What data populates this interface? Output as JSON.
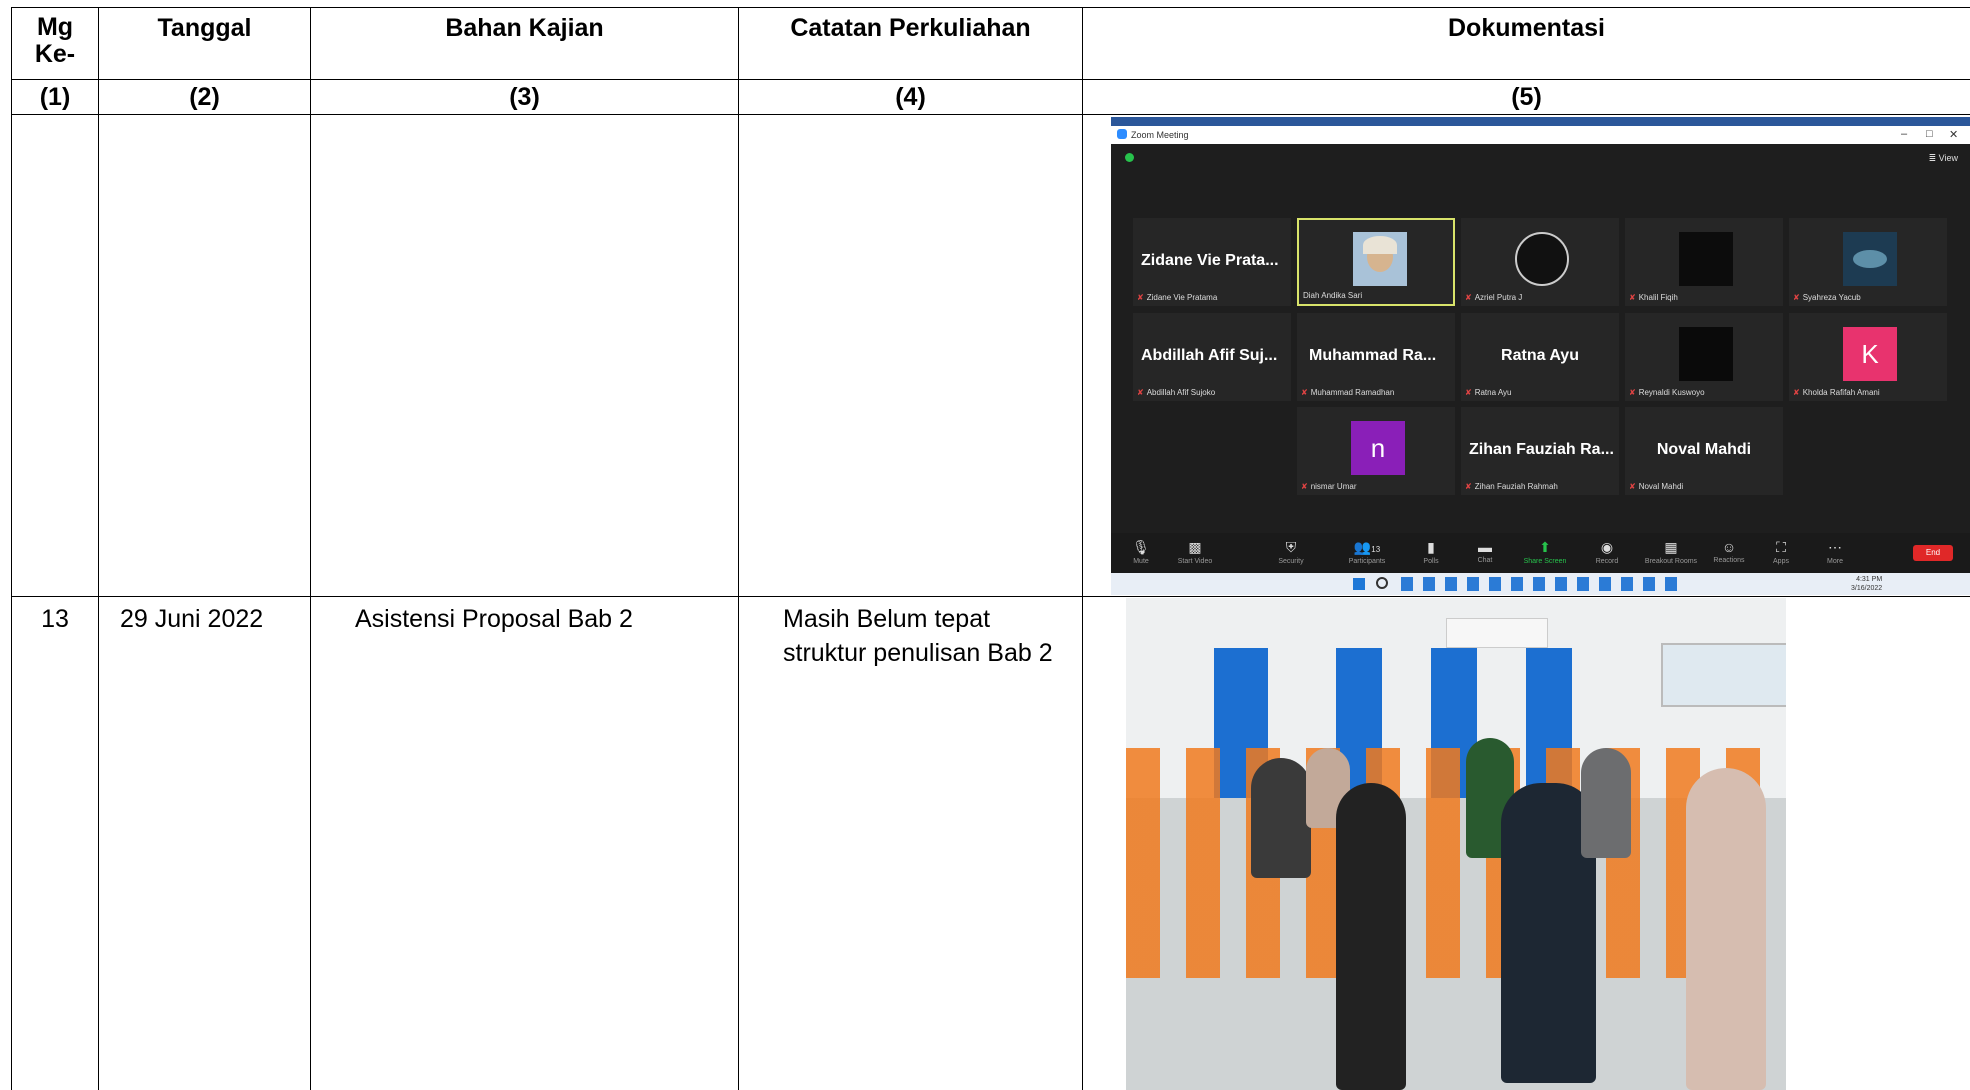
{
  "table": {
    "headers": [
      "Mg\nKe-",
      "Tanggal",
      "Bahan Kajian",
      "Catatan Perkuliahan",
      "Dokumentasi"
    ],
    "header_mg_line1": "Mg",
    "header_mg_line2": "Ke-",
    "numbers": [
      "(1)",
      "(2)",
      "(3)",
      "(4)",
      "(5)"
    ],
    "rows": [
      {
        "mg": "",
        "tanggal": "",
        "bahan": "",
        "catatan": ""
      },
      {
        "mg": "13",
        "tanggal": "29 Juni 2022",
        "bahan": "Asistensi Proposal Bab 2",
        "catatan_line1": "Masih Belum tepat",
        "catatan_line2": "struktur penulisan Bab 2"
      }
    ]
  },
  "zoom": {
    "window_title": "Zoom Meeting",
    "view_label": "View",
    "participants": [
      {
        "big": "Zidane Vie Prata...",
        "caption": "Zidane Vie Pratama"
      },
      {
        "big": "",
        "caption": "Diah Andika Sari"
      },
      {
        "big": "",
        "caption": "Azriel Putra J"
      },
      {
        "big": "",
        "caption": "Khalil Fiqih"
      },
      {
        "big": "",
        "caption": "Syahreza Yacub"
      },
      {
        "big": "Abdillah Afif Suj...",
        "caption": "Abdillah Afif Sujoko"
      },
      {
        "big": "Muhammad  Ra...",
        "caption": "Muhammad  Ramadhan"
      },
      {
        "big": "Ratna Ayu",
        "caption": "Ratna Ayu"
      },
      {
        "big": "",
        "caption": "Reynaldi Kuswoyo"
      },
      {
        "big": "K",
        "caption": "Kholda Rafifah Amani"
      },
      {
        "big": "n",
        "caption": "nismar Umar"
      },
      {
        "big": "Zihan Fauziah Ra...",
        "caption": "Zihan Fauziah Rahmah"
      },
      {
        "big": "Noval Mahdi",
        "caption": "Noval Mahdi"
      }
    ],
    "toolbar": [
      "Mute",
      "Start Video",
      "Security",
      "Participants",
      "Polls",
      "Chat",
      "Share Screen",
      "Record",
      "Breakout Rooms",
      "Reactions",
      "Apps",
      "More"
    ],
    "participant_count": "13",
    "end_label": "End",
    "clock_time": "4:31 PM",
    "clock_date": "3/16/2022"
  },
  "colors": {
    "zoom_bg": "#1e1e1e",
    "end_red": "#e02828",
    "k_avatar": "#e8336e",
    "n_avatar": "#8a1fb8",
    "speaker_border": "#d8e36a"
  }
}
